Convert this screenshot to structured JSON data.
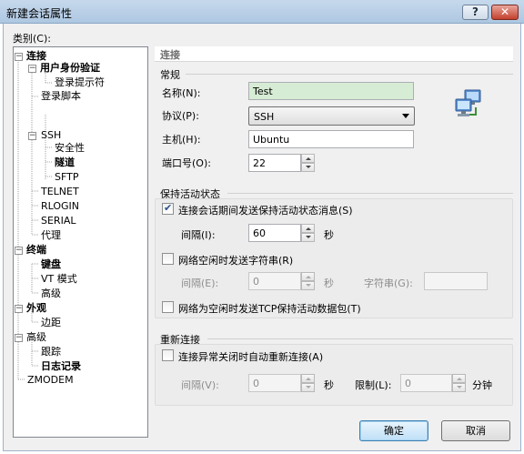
{
  "window": {
    "title": "新建会话属性",
    "help_label": "?",
    "close_label": "✕"
  },
  "category_label": "类别(C):",
  "tree": {
    "items": [
      {
        "label": "连接",
        "bold": true
      },
      {
        "label": "用户身份验证",
        "bold": true
      },
      {
        "label": "登录提示符",
        "bold": false
      },
      {
        "label": "登录脚本",
        "bold": false
      },
      {
        "label": "SSH",
        "bold": false
      },
      {
        "label": "安全性",
        "bold": false
      },
      {
        "label": "隧道",
        "bold": true
      },
      {
        "label": "SFTP",
        "bold": false
      },
      {
        "label": "TELNET",
        "bold": false
      },
      {
        "label": "RLOGIN",
        "bold": false
      },
      {
        "label": "SERIAL",
        "bold": false
      },
      {
        "label": "代理",
        "bold": false
      },
      {
        "label": "终端",
        "bold": true
      },
      {
        "label": "键盘",
        "bold": true
      },
      {
        "label": "VT 模式",
        "bold": false
      },
      {
        "label": "高级",
        "bold": false
      },
      {
        "label": "外观",
        "bold": true
      },
      {
        "label": "边距",
        "bold": false
      },
      {
        "label": "高级",
        "bold": false
      },
      {
        "label": "跟踪",
        "bold": false
      },
      {
        "label": "日志记录",
        "bold": true
      },
      {
        "label": "ZMODEM",
        "bold": false
      }
    ],
    "expander_symbol": "−"
  },
  "panel": {
    "header": "连接",
    "general": {
      "title": "常规",
      "name_label": "名称(N):",
      "name_value": "Test",
      "protocol_label": "协议(P):",
      "protocol_value": "SSH",
      "host_label": "主机(H):",
      "host_value": "Ubuntu",
      "port_label": "端口号(O):",
      "port_value": "22"
    },
    "keepalive": {
      "title": "保持活动状态",
      "send_keepalive_label": "连接会话期间发送保持活动状态消息(S)",
      "send_keepalive_checked": true,
      "interval_label": "间隔(I):",
      "interval_value": "60",
      "seconds_label": "秒",
      "idle_string_label": "网络空闲时发送字符串(R)",
      "idle_string_checked": false,
      "idle_interval_label": "间隔(E):",
      "idle_interval_value": "0",
      "idle_seconds_label": "秒",
      "string_label": "字符串(G):",
      "string_value": "",
      "tcp_keepalive_label": "网络为空闲时发送TCP保持活动数据包(T)",
      "tcp_keepalive_checked": false
    },
    "reconnect": {
      "title": "重新连接",
      "auto_reconnect_label": "连接异常关闭时自动重新连接(A)",
      "auto_reconnect_checked": false,
      "interval_label": "间隔(V):",
      "interval_value": "0",
      "seconds_label": "秒",
      "limit_label": "限制(L):",
      "limit_value": "0",
      "minutes_label": "分钟"
    }
  },
  "footer": {
    "ok_label": "确定",
    "cancel_label": "取消"
  },
  "colors": {
    "name_field_bg": "#d7ecd4",
    "ok_button_border": "#3c7fb1"
  },
  "icons": [
    "network-computers-icon"
  ]
}
